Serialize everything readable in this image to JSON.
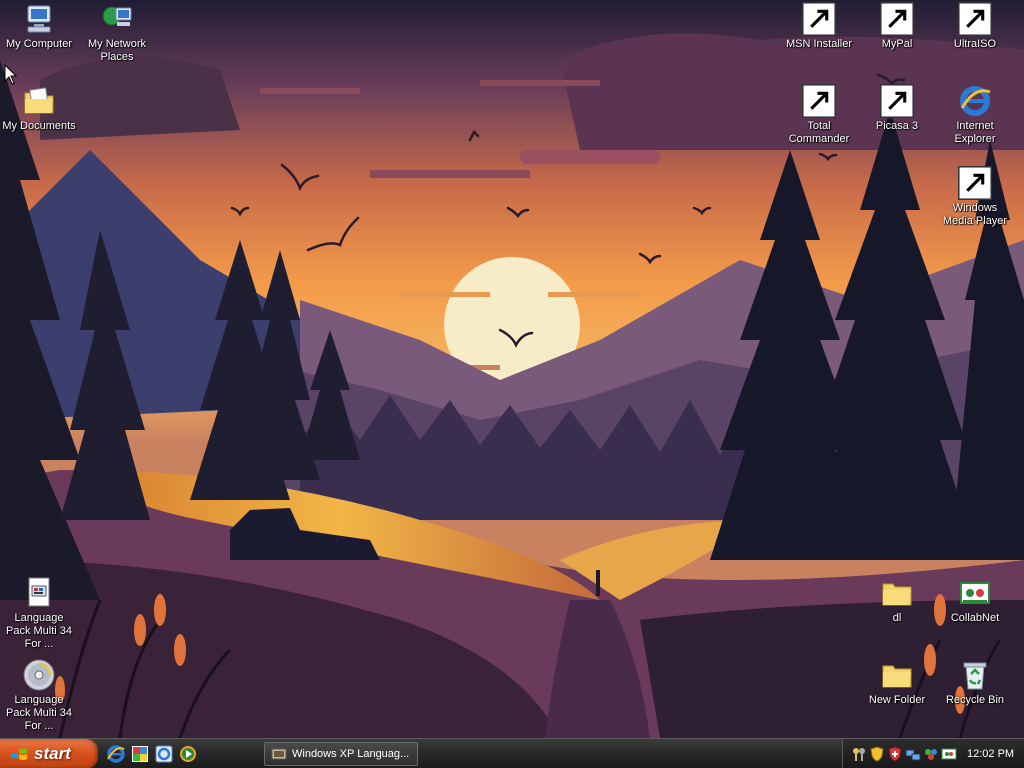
{
  "desktop": {
    "icons_left": [
      {
        "label": "My Computer"
      },
      {
        "label": "My Network Places"
      },
      {
        "label": "My Documents"
      },
      {
        "label": "Language Pack Multi 34 For ..."
      },
      {
        "label": "Language Pack Multi 34 For ..."
      }
    ],
    "icons_right": [
      {
        "label": "MSN Installer"
      },
      {
        "label": "MyPal"
      },
      {
        "label": "UltraISO"
      },
      {
        "label": "Total Commander"
      },
      {
        "label": "Picasa 3"
      },
      {
        "label": "Internet Explorer"
      },
      {
        "label": "Windows Media Player"
      },
      {
        "label": "dl"
      },
      {
        "label": "CollabNet"
      },
      {
        "label": "New Folder"
      },
      {
        "label": "Recycle Bin"
      }
    ]
  },
  "taskbar": {
    "start_label": "start",
    "quick_launch": [
      "internet-explorer-icon",
      "picasa-icon",
      "ie-alt-icon",
      "media-player-icon"
    ],
    "task_window_label": "Windows XP Languag...",
    "tray_icons": [
      "keys-icon",
      "security-shield-icon",
      "antivirus-icon",
      "network-icon",
      "network-alt-icon",
      "collabnet-icon"
    ],
    "clock": "12:02 PM"
  },
  "colors": {
    "sun": "#f7ecc8",
    "sky_top": "#2a2038",
    "sky_orange": "#f29a4a",
    "start_orange": "#d9531e"
  }
}
